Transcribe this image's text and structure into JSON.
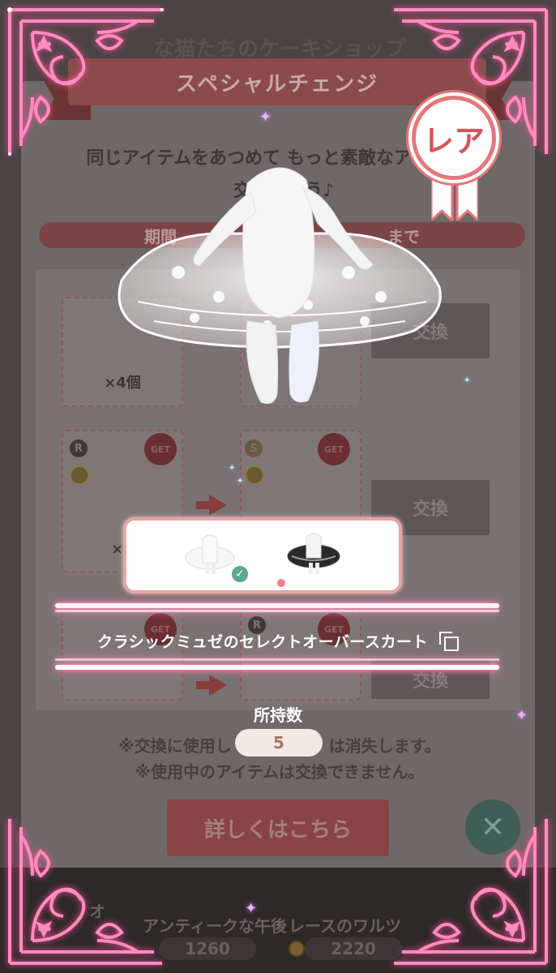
{
  "background": {
    "top_title_partial": "な猫たちのケーキショップ",
    "banner_title": "スペシャルチェンジ",
    "description_line1": "同じアイテムをあつめて もっと素敵なアイテムと",
    "description_line2": "交換しよう♪",
    "period_text": "期間　　　　　　　　　　　　　まで",
    "rows": [
      {
        "count": "×4個",
        "exchange_label": "交換"
      },
      {
        "count": "×6",
        "exchange_label": "交換",
        "badge_rarity": "R",
        "target_rarity": "S",
        "get_label": "GET"
      },
      {
        "exchange_label": "交換",
        "badge_rarity": "R",
        "get_label": "GET"
      }
    ],
    "note_line1": "※交換に使用し　　　　　　は消失します。",
    "note_line2": "※使用中のアイテムは交換できません。",
    "detail_button": "詳しくはこちら",
    "shop_items": [
      {
        "label": "アンティークな午後",
        "price": "1260"
      },
      {
        "label": "レースのワルツ",
        "price": "2220"
      }
    ],
    "shop_left_partial": "オ"
  },
  "popup": {
    "rarity_badge": "レア",
    "item_name": "クラシックミュゼのセレクトオーバースカート",
    "owned_label": "所持数",
    "owned_value": "5",
    "variants": [
      {
        "name": "white-skirt",
        "selected": true
      },
      {
        "name": "black-skirt",
        "selected": false
      }
    ],
    "selected_dot": "•"
  },
  "colors": {
    "frame_pink": "#ff7fb6",
    "rare_red": "#d6535a",
    "check_green": "#5aa890",
    "owned_pill": "#f4e8e6"
  }
}
